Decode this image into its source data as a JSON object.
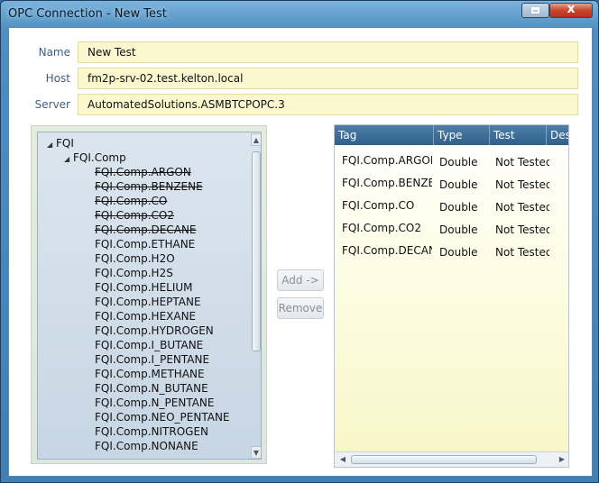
{
  "window": {
    "title": "OPC Connection - New Test",
    "close_glyph": "x"
  },
  "form": {
    "name_label": "Name",
    "name_value": "New Test",
    "host_label": "Host",
    "host_value": "fm2p-srv-02.test.kelton.local",
    "server_label": "Server",
    "server_value": "AutomatedSolutions.ASMBTCPOPC.3"
  },
  "tree": {
    "root": "FQI",
    "group": "FQI.Comp",
    "items": [
      {
        "label": "FQI.Comp.ARGON",
        "added": true
      },
      {
        "label": "FQI.Comp.BENZENE",
        "added": true
      },
      {
        "label": "FQI.Comp.CO",
        "added": true
      },
      {
        "label": "FQI.Comp.CO2",
        "added": true
      },
      {
        "label": "FQI.Comp.DECANE",
        "added": true
      },
      {
        "label": "FQI.Comp.ETHANE",
        "added": false
      },
      {
        "label": "FQI.Comp.H2O",
        "added": false
      },
      {
        "label": "FQI.Comp.H2S",
        "added": false
      },
      {
        "label": "FQI.Comp.HELIUM",
        "added": false
      },
      {
        "label": "FQI.Comp.HEPTANE",
        "added": false
      },
      {
        "label": "FQI.Comp.HEXANE",
        "added": false
      },
      {
        "label": "FQI.Comp.HYDROGEN",
        "added": false
      },
      {
        "label": "FQI.Comp.I_BUTANE",
        "added": false
      },
      {
        "label": "FQI.Comp.I_PENTANE",
        "added": false
      },
      {
        "label": "FQI.Comp.METHANE",
        "added": false
      },
      {
        "label": "FQI.Comp.N_BUTANE",
        "added": false
      },
      {
        "label": "FQI.Comp.N_PENTANE",
        "added": false
      },
      {
        "label": "FQI.Comp.NEO_PENTANE",
        "added": false
      },
      {
        "label": "FQI.Comp.NITROGEN",
        "added": false
      },
      {
        "label": "FQI.Comp.NONANE",
        "added": false
      }
    ]
  },
  "buttons": {
    "add_label": "Add ->",
    "remove_label": "Remove"
  },
  "grid": {
    "columns": [
      "Tag",
      "Type",
      "Test",
      "Des"
    ],
    "rows": [
      [
        "FQI.Comp.ARGON",
        "Double",
        "Not Tested"
      ],
      [
        "FQI.Comp.BENZENE",
        "Double",
        "Not Tested"
      ],
      [
        "FQI.Comp.CO",
        "Double",
        "Not Tested"
      ],
      [
        "FQI.Comp.CO2",
        "Double",
        "Not Tested"
      ],
      [
        "FQI.Comp.DECANE",
        "Double",
        "Not Tested"
      ]
    ]
  },
  "icons": {
    "expand": "expanded-triangle-icon",
    "scroll_up": "scroll-up-arrow-icon",
    "scroll_down": "scroll-down-arrow-icon",
    "scroll_left": "scroll-left-arrow-icon",
    "scroll_right": "scroll-right-arrow-icon"
  },
  "colors": {
    "field_background": "#fbf8cf",
    "grid_header": "#3f6f99",
    "close_button": "#c8462d"
  }
}
